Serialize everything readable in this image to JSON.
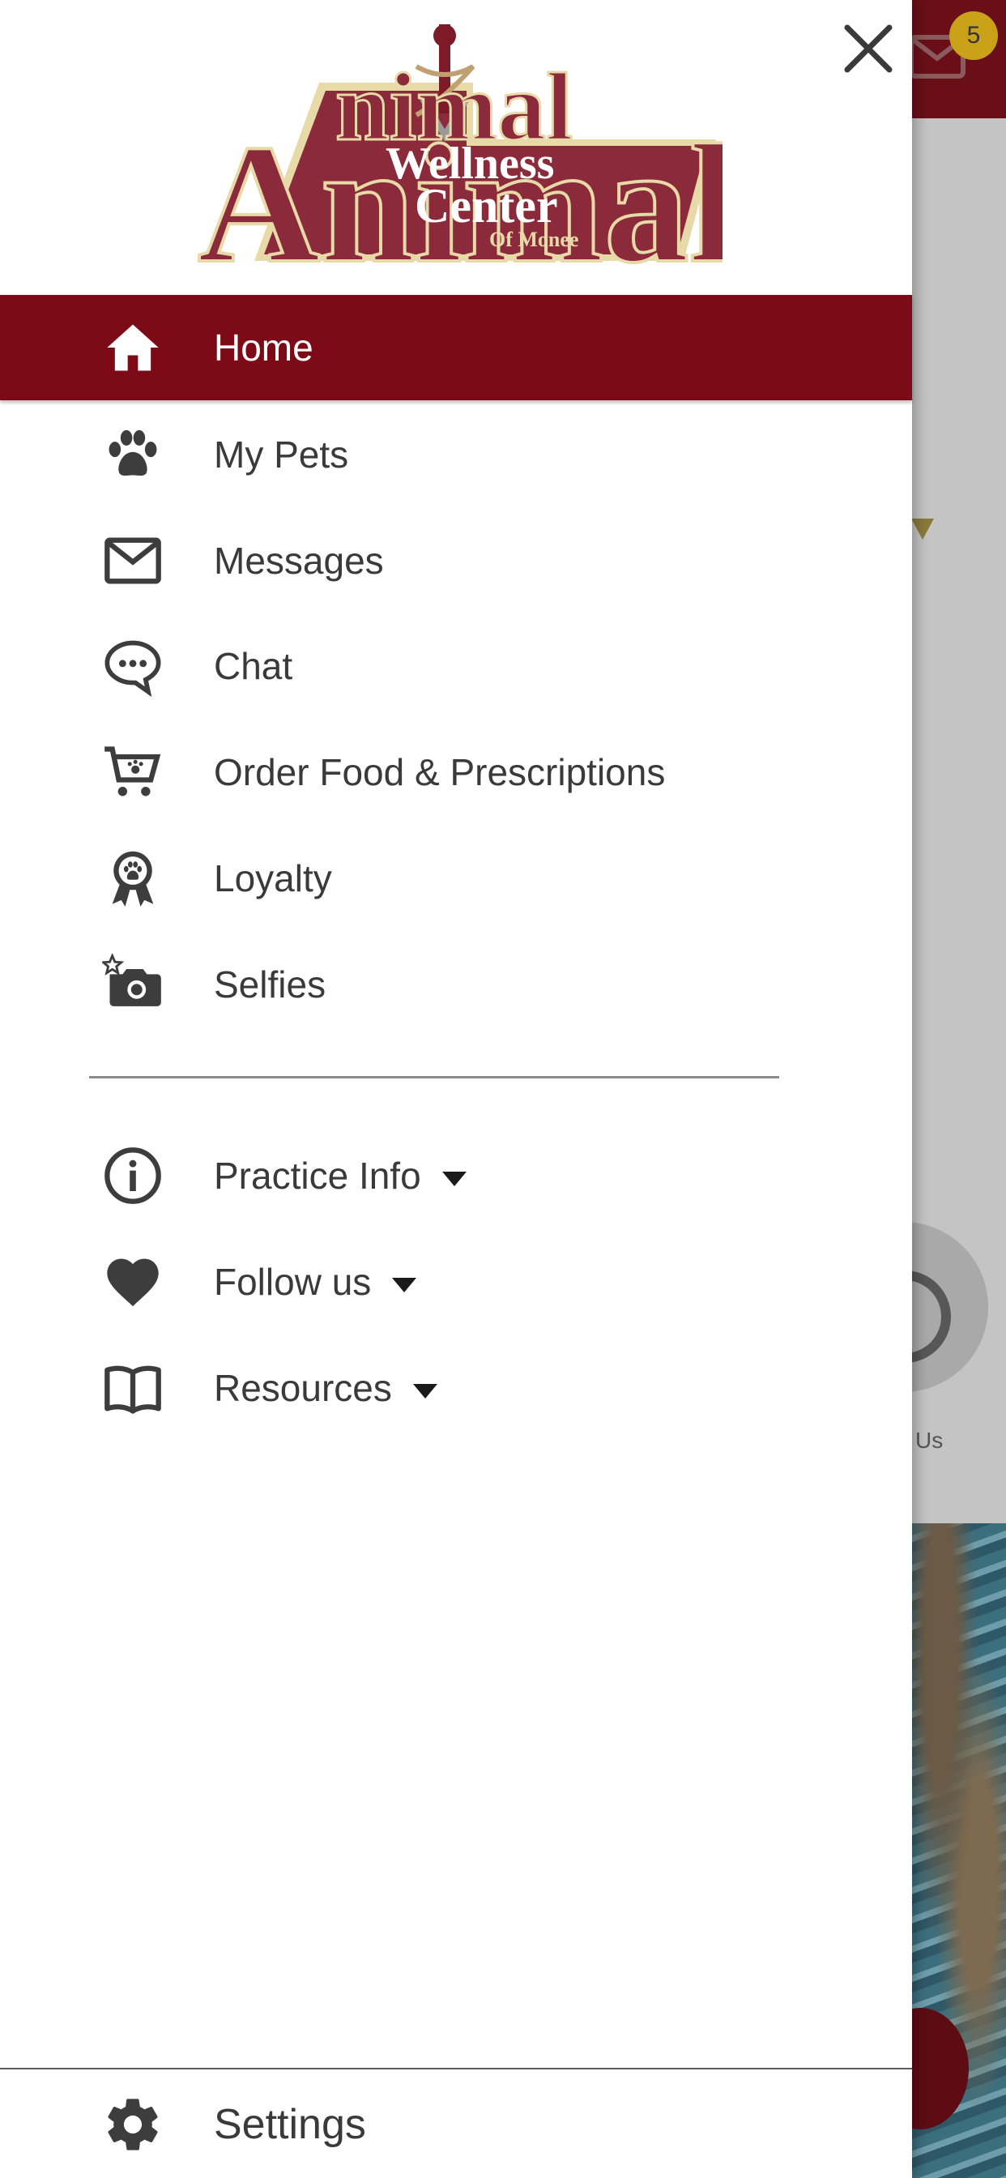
{
  "background": {
    "message_badge_count": "5",
    "partial_label": "Us",
    "colors": {
      "header": "#6a0f18",
      "badge": "#c9a21a"
    }
  },
  "drawer": {
    "close_icon": "close-icon",
    "logo": {
      "line1": "Animal",
      "line2": "Wellness",
      "line3": "Center",
      "line4": "Of Monee"
    },
    "items": [
      {
        "label": "Home",
        "icon": "home-icon",
        "active": true
      },
      {
        "label": "My Pets",
        "icon": "paw-icon"
      },
      {
        "label": "Messages",
        "icon": "mail-icon"
      },
      {
        "label": "Chat",
        "icon": "chat-icon"
      },
      {
        "label": "Order Food & Prescriptions",
        "icon": "cart-icon"
      },
      {
        "label": "Loyalty",
        "icon": "award-icon"
      },
      {
        "label": "Selfies",
        "icon": "camera-icon"
      }
    ],
    "expandable": [
      {
        "label": "Practice Info",
        "icon": "info-icon"
      },
      {
        "label": "Follow us",
        "icon": "heart-icon"
      },
      {
        "label": "Resources",
        "icon": "book-icon"
      }
    ],
    "settings": {
      "label": "Settings",
      "icon": "gear-icon"
    },
    "colors": {
      "active_bg": "#7d0a17",
      "text": "#3a3a3a",
      "icon": "#3d3d3d"
    }
  }
}
